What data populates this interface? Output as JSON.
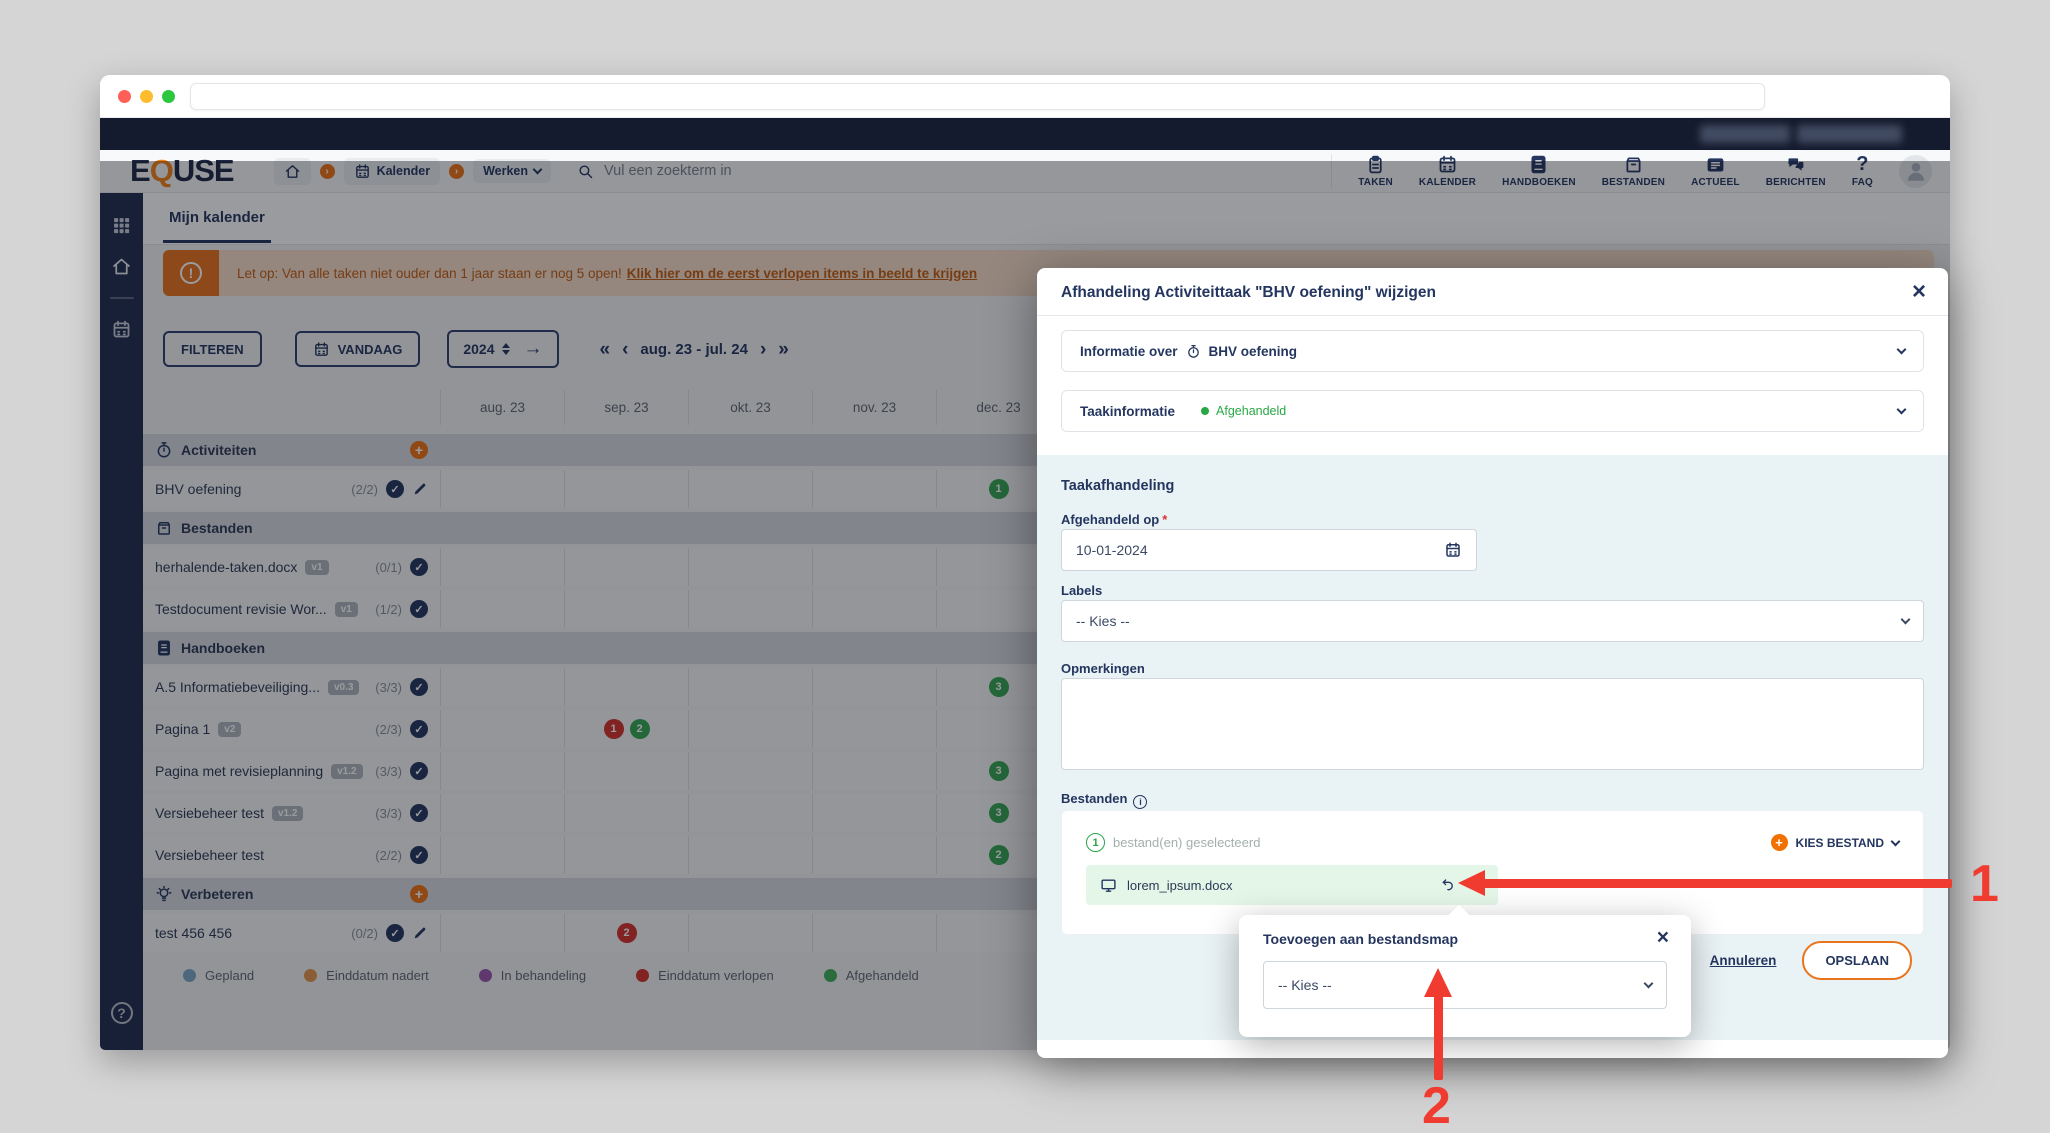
{
  "header": {
    "logo": {
      "pre": "E",
      "q": "Q",
      "post": "USE"
    },
    "breadcrumb": {
      "kalender": "Kalender",
      "werken": "Werken"
    },
    "search": {
      "placeholder": "Vul een zoekterm in"
    },
    "menu": [
      {
        "label": "TAKEN",
        "icon": "clipboard-icon"
      },
      {
        "label": "KALENDER",
        "icon": "calendar-icon"
      },
      {
        "label": "HANDBOEKEN",
        "icon": "book-icon"
      },
      {
        "label": "BESTANDEN",
        "icon": "archive-icon"
      },
      {
        "label": "ACTUEEL",
        "icon": "newspaper-icon"
      },
      {
        "label": "BERICHTEN",
        "icon": "chat-icon"
      },
      {
        "label": "FAQ",
        "icon": "question-icon"
      }
    ]
  },
  "tabs": {
    "active": "Mijn kalender"
  },
  "banner": {
    "text": "Let op: Van alle taken niet ouder dan 1 jaar staan er nog 5 open!",
    "link": "Klik hier om de eerst verlopen items in beeld te krijgen"
  },
  "toolbar": {
    "filter": "FILTEREN",
    "today": "VANDAAG",
    "year": "2024",
    "range": "aug. 23 - jul. 24",
    "prev_double": "«",
    "prev": "‹",
    "next": "›",
    "next_double": "»",
    "go_arrow": "→"
  },
  "calendar": {
    "months": [
      "aug. 23",
      "sep. 23",
      "okt. 23",
      "nov. 23",
      "dec. 23"
    ],
    "total_columns": 12,
    "rows": [
      {
        "type": "group",
        "label": "Activiteiten",
        "icon": "stopwatch-icon",
        "add": true
      },
      {
        "type": "item",
        "label": "BHV oefening",
        "count": "(2/2)",
        "check": true,
        "edit": true,
        "badges": [
          {
            "col": 4,
            "color": "green",
            "value": "1"
          }
        ]
      },
      {
        "type": "group",
        "label": "Bestanden",
        "icon": "archive-icon",
        "add": false
      },
      {
        "type": "item",
        "label": "herhalende-taken.docx",
        "version": "v1",
        "count": "(0/1)",
        "check": true,
        "badges": []
      },
      {
        "type": "item",
        "label": "Testdocument revisie Wor...",
        "version": "v1",
        "count": "(1/2)",
        "check": true,
        "badges": []
      },
      {
        "type": "group",
        "label": "Handboeken",
        "icon": "book-icon",
        "add": false
      },
      {
        "type": "item",
        "label": "A.5 Informatiebeveiliging...",
        "version": "v0.3",
        "count": "(3/3)",
        "check": true,
        "badges": [
          {
            "col": 4,
            "color": "green",
            "value": "3"
          }
        ]
      },
      {
        "type": "item",
        "label": "Pagina 1",
        "version": "v2",
        "count": "(2/3)",
        "check": true,
        "badges": [
          {
            "col": 1,
            "color": "red",
            "value": "1"
          },
          {
            "col": 1,
            "color": "green",
            "value": "2"
          }
        ]
      },
      {
        "type": "item",
        "label": "Pagina met revisieplanning",
        "version": "v1.2",
        "count": "(3/3)",
        "check": true,
        "badges": [
          {
            "col": 4,
            "color": "green",
            "value": "3"
          }
        ]
      },
      {
        "type": "item",
        "label": "Versiebeheer test",
        "version": "v1.2",
        "count": "(3/3)",
        "check": true,
        "badges": [
          {
            "col": 4,
            "color": "green",
            "value": "3"
          }
        ]
      },
      {
        "type": "item",
        "label": "Versiebeheer test",
        "count": "(2/2)",
        "check": true,
        "badges": [
          {
            "col": 4,
            "color": "green",
            "value": "2"
          }
        ]
      },
      {
        "type": "group",
        "label": "Verbeteren",
        "icon": "bulb-icon",
        "add": true
      },
      {
        "type": "item",
        "label": "test 456 456",
        "count": "(0/2)",
        "check": true,
        "edit": true,
        "badges": [
          {
            "col": 1,
            "color": "red",
            "value": "2"
          }
        ]
      }
    ],
    "legend": [
      {
        "label": "Gepland",
        "color": "#7ba7c7"
      },
      {
        "label": "Einddatum nadert",
        "color": "#e6954d"
      },
      {
        "label": "In behandeling",
        "color": "#9a55ae"
      },
      {
        "label": "Einddatum verlopen",
        "color": "#d4302b"
      },
      {
        "label": "Afgehandeld",
        "color": "#3fae59"
      }
    ]
  },
  "badge_colors": {
    "green": "#35a853",
    "red": "#d4302b"
  },
  "modal": {
    "title": "Afhandeling Activiteittaak \"BHV oefening\" wijzigen",
    "close": "×",
    "accordion1": {
      "prefix": "Informatie over",
      "task": "BHV oefening"
    },
    "accordion2": {
      "label": "Taakinformatie",
      "status": "Afgehandeld"
    },
    "section_title": "Taakafhandeling",
    "afgehandeld_op": {
      "label": "Afgehandeld op",
      "required": "*",
      "value": "10-01-2024"
    },
    "labels_field": {
      "label": "Labels",
      "value": "-- Kies --"
    },
    "opmerkingen": {
      "label": "Opmerkingen"
    },
    "bestanden": {
      "label": "Bestanden",
      "count": "1",
      "count_text": "bestand(en) geselecteerd",
      "choose": "KIES BESTAND",
      "file": "lorem_ipsum.docx"
    },
    "footer": {
      "cancel": "Annuleren",
      "save": "OPSLAAN"
    }
  },
  "popup": {
    "title": "Toevoegen aan bestandsmap",
    "close": "×",
    "select": "-- Kies --"
  },
  "annotations": {
    "step1": "1",
    "step2": "2"
  }
}
